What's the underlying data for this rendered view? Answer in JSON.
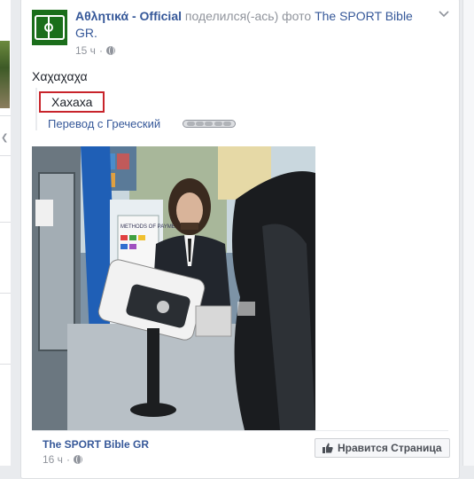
{
  "post": {
    "author": "Αθλητικά - Official",
    "action_text": "поделился(-ась) фото",
    "shared_from": "The SPORT Bible GR.",
    "time": "15 ч",
    "dot": "·",
    "text": "Χαχαχαχα"
  },
  "translation": {
    "text": "Хахаха",
    "link": "Перевод с Греческий"
  },
  "footer": {
    "page_name": "The SPORT Bible GR",
    "time": "16 ч",
    "dot": "·",
    "like_button_label": "Нравится Страница"
  },
  "photo": {
    "card_texts": [
      "METHODS OF PAYMENT"
    ]
  },
  "icons": {
    "avatar": "soccer-pitch-icon",
    "privacy": "globe-icon",
    "menu": "chevron-down-icon",
    "like": "thumbs-up-icon"
  },
  "colors": {
    "link": "#365899",
    "highlight_border": "#c8242b",
    "meta": "#90949c"
  }
}
